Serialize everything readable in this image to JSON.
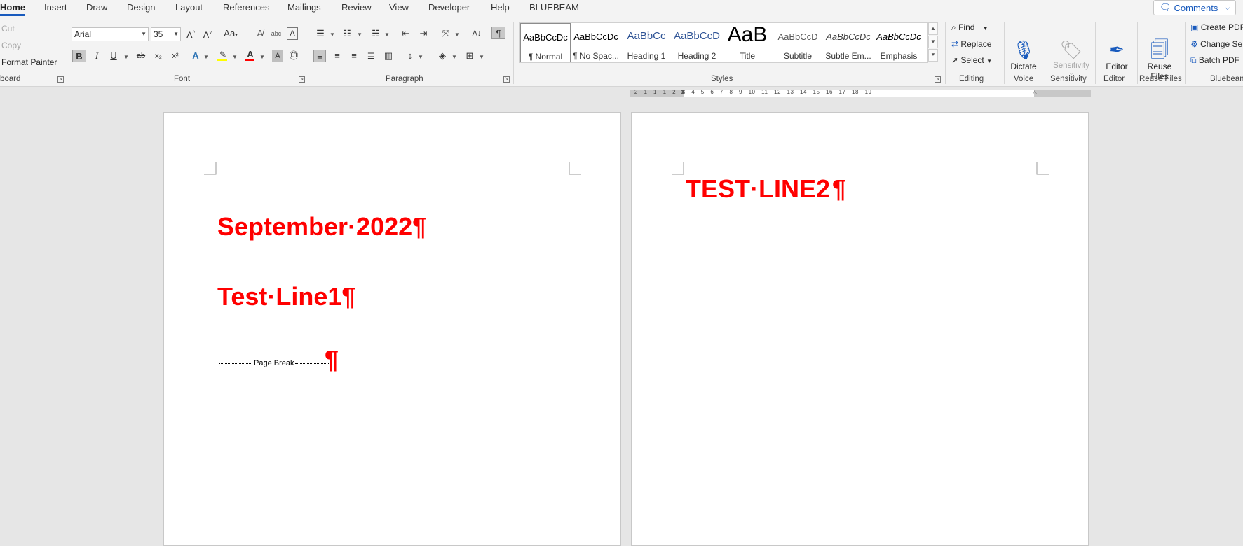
{
  "tabs": [
    "Home",
    "Insert",
    "Draw",
    "Design",
    "Layout",
    "References",
    "Mailings",
    "Review",
    "View",
    "Developer",
    "Help",
    "BLUEBEAM"
  ],
  "comments_label": "Comments",
  "clipboard": {
    "cut": "Cut",
    "copy": "Copy",
    "format_painter": "Format Painter",
    "label": "board"
  },
  "font": {
    "name": "Arial",
    "size": "35",
    "label": "Font",
    "grow": "A^",
    "shrink": "A˅",
    "case": "Aa",
    "bold": "B",
    "italic": "I",
    "underline": "U",
    "strike": "ab",
    "sub": "x₂",
    "sup": "x²"
  },
  "paragraph": {
    "label": "Paragraph"
  },
  "styles": {
    "label": "Styles",
    "items": [
      {
        "preview": "AaBbCcDc",
        "name": "¶ Normal",
        "color": "#000000"
      },
      {
        "preview": "AaBbCcDc",
        "name": "¶ No Spac...",
        "color": "#000000"
      },
      {
        "preview": "AaBbCc",
        "name": "Heading 1",
        "color": "#2f5496"
      },
      {
        "preview": "AaBbCcD",
        "name": "Heading 2",
        "color": "#2f5496"
      },
      {
        "preview": "AaB",
        "name": "Title",
        "color": "#000000"
      },
      {
        "preview": "AaBbCcD",
        "name": "Subtitle",
        "color": "#595959"
      },
      {
        "preview": "AaBbCcDc",
        "name": "Subtle Em...",
        "color": "#404040"
      },
      {
        "preview": "AaBbCcDc",
        "name": "Emphasis",
        "color": "#000000"
      }
    ]
  },
  "editing": {
    "find": "Find",
    "replace": "Replace",
    "select": "Select",
    "label": "Editing"
  },
  "voice": {
    "dictate": "Dictate",
    "label": "Voice"
  },
  "sensitivity": {
    "button": "Sensitivity",
    "label": "Sensitivity"
  },
  "editor": {
    "button": "Editor",
    "label": "Editor"
  },
  "reuse": {
    "button_line1": "Reuse",
    "button_line2": "Files",
    "label": "Reuse Files"
  },
  "bluebeam": {
    "create": "Create PDF",
    "change": "Change Se",
    "batch": "Batch PDF",
    "label": "Bluebeam"
  },
  "ruler_text": "· 2 · 1 · 1 · 1 · 2 · 3 · 4 · 5 · 6 · 7 · 8 · 9 · 10 · 11 · 12 · 13 · 14 · 15 · 16 · 17 · 18 · 19",
  "document": {
    "page1": {
      "line1": "September·2022¶",
      "line2": "Test·Line1¶",
      "page_break": "Page Break",
      "pilcrow": "¶"
    },
    "page2": {
      "line1": "TEST·LINE2",
      "pilcrow": "¶"
    }
  },
  "colors": {
    "accent": "#185abd",
    "doc_text": "#ff0000",
    "highlight": "#ffff00",
    "font_color": "#ff0000"
  }
}
